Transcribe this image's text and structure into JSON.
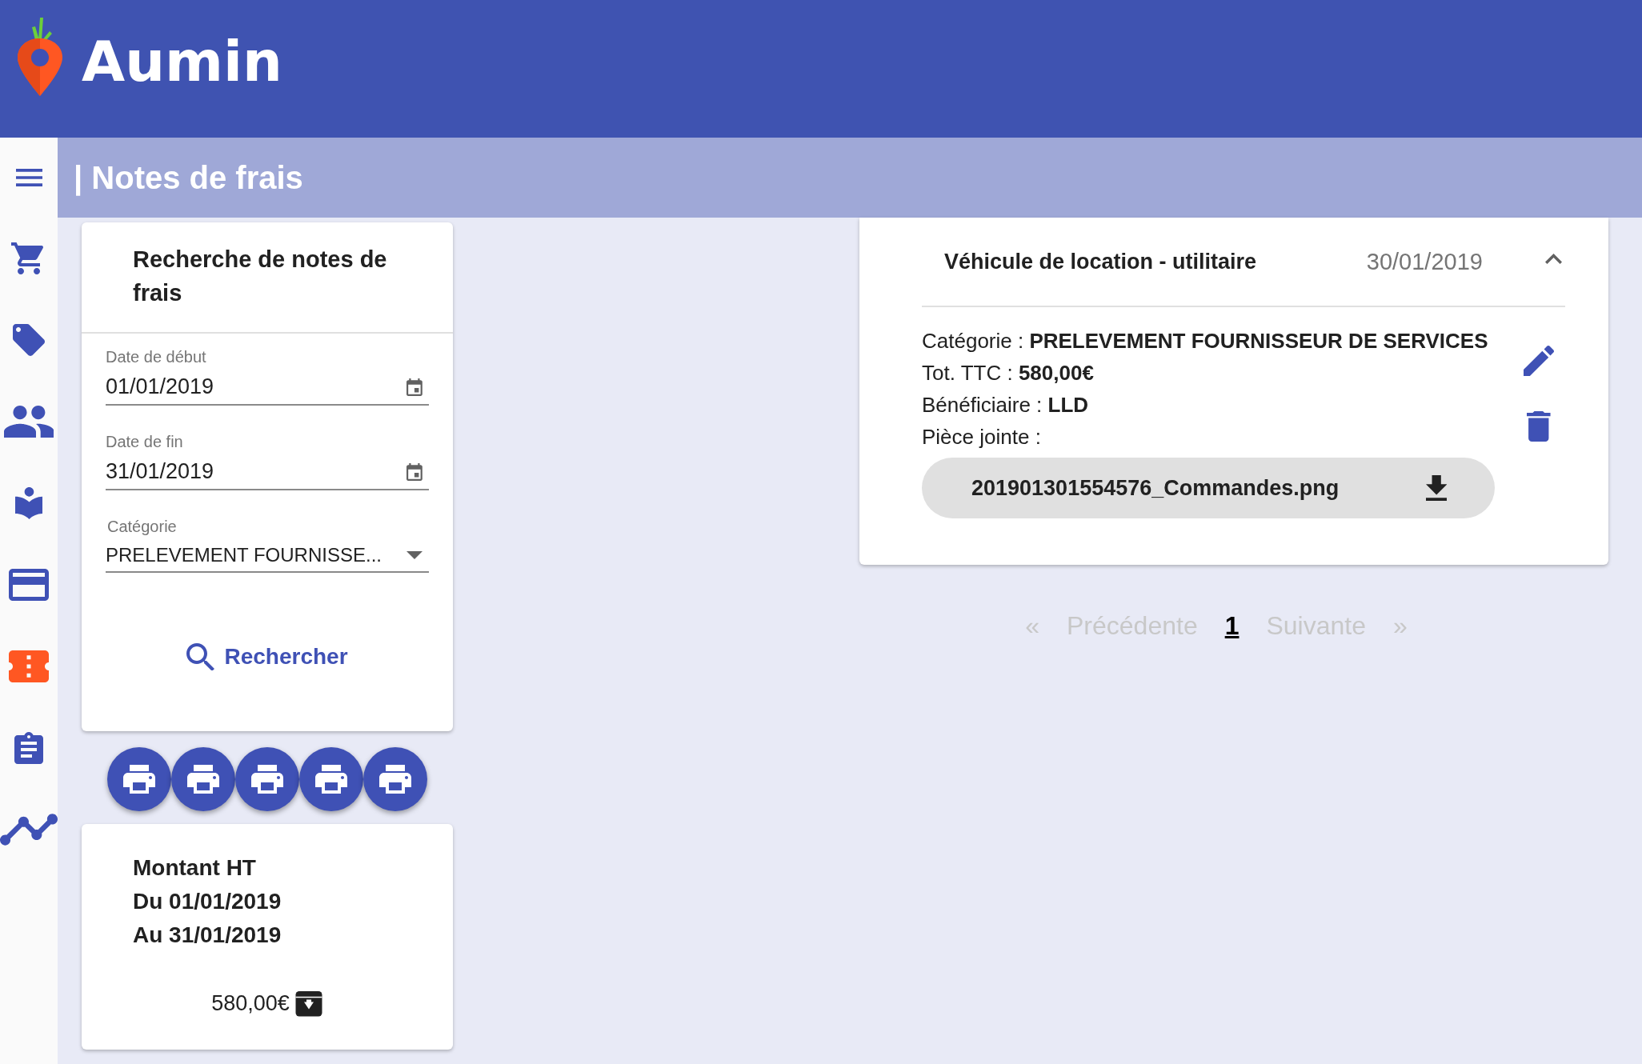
{
  "header": {
    "logo_text": "Aumin"
  },
  "title_bar": {
    "title": "| Notes de frais"
  },
  "sidebar": {
    "items": [
      {
        "kind": "cart",
        "selected": false
      },
      {
        "kind": "tag",
        "selected": false
      },
      {
        "kind": "people",
        "selected": false
      },
      {
        "kind": "reader",
        "selected": false
      },
      {
        "kind": "card",
        "selected": false
      },
      {
        "kind": "ticket",
        "selected": true
      },
      {
        "kind": "clipboard",
        "selected": false
      },
      {
        "kind": "chart",
        "selected": false
      }
    ]
  },
  "search_card": {
    "title": "Recherche de notes de frais",
    "fields": [
      {
        "kind": "date",
        "label": "Date de début",
        "value": "01/01/2019"
      },
      {
        "kind": "date",
        "label": "Date de fin",
        "value": "31/01/2019"
      },
      {
        "kind": "select",
        "label": "Catégorie",
        "value": "PRELEVEMENT FOURNISSE..."
      }
    ],
    "search_button": "Rechercher"
  },
  "print_buttons": [
    {
      "kind": "print"
    },
    {
      "kind": "print"
    },
    {
      "kind": "print"
    },
    {
      "kind": "print"
    },
    {
      "kind": "print"
    }
  ],
  "total_card": {
    "lines": [
      "Montant HT",
      "Du 01/01/2019",
      "Au 31/01/2019"
    ],
    "amount": "580,00€"
  },
  "expense": {
    "title": "Véhicule de location - utilitaire",
    "date": "30/01/2019",
    "expanded": true,
    "details": [
      "Catégorie : **PRELEVEMENT FOURNISSEUR DE SERVICES**",
      "Tot. TTC : **580,00€**",
      "Bénéficiaire : **LLD**",
      "Pièce jointe :"
    ],
    "attachment": "201901301554576_Commandes.png"
  },
  "pagination": [
    {
      "label": "«",
      "disabled": true,
      "selected": false
    },
    {
      "label": "Précédente",
      "disabled": true,
      "selected": false
    },
    {
      "label": "1",
      "disabled": false,
      "selected": true
    },
    {
      "label": "Suivante",
      "disabled": true,
      "selected": false
    },
    {
      "label": "»",
      "disabled": true,
      "selected": false
    }
  ]
}
